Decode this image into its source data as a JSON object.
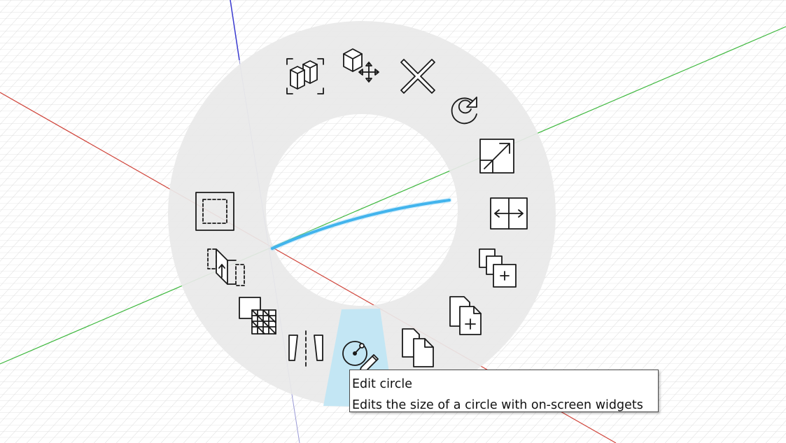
{
  "viewport": {
    "axis_colors": {
      "x": "#d0453b",
      "y": "#3fb83f",
      "z": "#3a3ad0"
    },
    "grid_color": "#d6d6d6",
    "sketch_curve_color": "#1aa3e8"
  },
  "marking_menu": {
    "ring_color": "#e9e9e9",
    "highlight_color": "#c3e6f4",
    "items": [
      {
        "id": "fit-view",
        "icon": "frame-boxes-icon"
      },
      {
        "id": "move",
        "icon": "move-box-icon"
      },
      {
        "id": "delete",
        "icon": "x-delete-icon"
      },
      {
        "id": "repeat",
        "icon": "repeat-arrow-icon"
      },
      {
        "id": "scale",
        "icon": "scale-diagonal-icon"
      },
      {
        "id": "stretch",
        "icon": "stretch-horizontal-icon"
      },
      {
        "id": "copy-paste-plus",
        "icon": "copy-plus-icon"
      },
      {
        "id": "new-document",
        "icon": "document-plus-icon"
      },
      {
        "id": "copy",
        "icon": "copy-docs-icon"
      },
      {
        "id": "edit-circle",
        "icon": "edit-circle-icon",
        "highlighted": true
      },
      {
        "id": "mirror",
        "icon": "mirror-icon"
      },
      {
        "id": "hatch",
        "icon": "hatch-fill-icon"
      },
      {
        "id": "extrude",
        "icon": "extrude-icon"
      },
      {
        "id": "select-region",
        "icon": "dashed-square-icon"
      }
    ]
  },
  "tooltip": {
    "title": "Edit circle",
    "description": "Edits the size of a circle with on-screen widgets"
  }
}
